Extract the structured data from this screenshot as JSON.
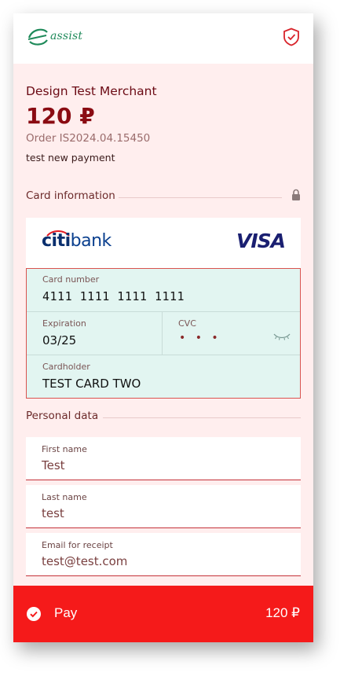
{
  "header": {
    "logo_text": "assist",
    "logo_icon": "assist-logo-icon",
    "security_icon": "shield-check-icon"
  },
  "summary": {
    "merchant": "Design Test Merchant",
    "amount": "120 ₽",
    "order": "Order  IS2024.04.15450",
    "description": "test new payment"
  },
  "card_section": {
    "title": "Card information",
    "lock_icon": "lock-icon",
    "bank_name_part1": "citi",
    "bank_name_part2": "bank",
    "network": "VISA",
    "number_label": "Card number",
    "number_value": "4111 1111 1111 1111",
    "expiration_label": "Expiration",
    "expiration_value": "03/25",
    "cvc_label": "CVC",
    "cvc_value": "• • •",
    "cvc_visibility_icon": "eye-closed-icon",
    "holder_label": "Cardholder",
    "holder_value": "TEST CARD TWO"
  },
  "personal_section": {
    "title": "Personal data",
    "fields": [
      {
        "label": "First name",
        "value": "Test"
      },
      {
        "label": "Last name",
        "value": "test"
      },
      {
        "label": "Email for receipt",
        "value": "test@test.com"
      }
    ]
  },
  "pay_button": {
    "label": "Pay",
    "amount": "120 ₽",
    "icon": "check-circle-icon"
  },
  "colors": {
    "accent_red": "#f51a1a",
    "amount_color": "#8a0b12",
    "card_field_bg": "#e2f5f1",
    "page_bg": "#ffeeee"
  }
}
